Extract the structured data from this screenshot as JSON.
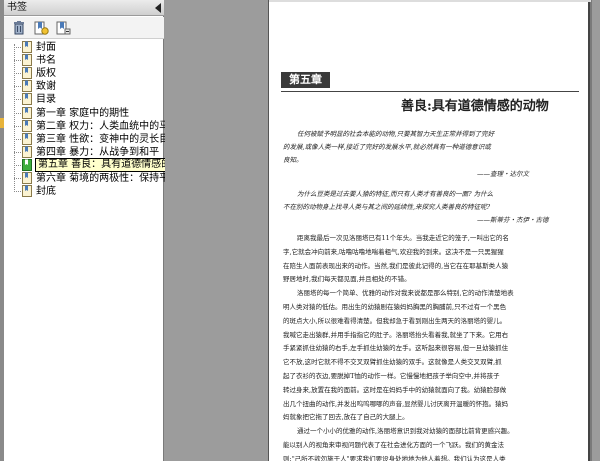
{
  "panel": {
    "title": "书签",
    "toolbar": [
      "delete-bookmark",
      "new-bookmark",
      "bookmark-options"
    ]
  },
  "bookmarks": [
    {
      "label": "封面"
    },
    {
      "label": "书名"
    },
    {
      "label": "版权"
    },
    {
      "label": "致谢"
    },
    {
      "label": "目录"
    },
    {
      "label": "第一章  家庭中的期性"
    },
    {
      "label": "第二章  权力：人类血统中的马基利"
    },
    {
      "label": "第三章  性欲：变神中的灵长目"
    },
    {
      "label": "第四章  暴力：从战争到和平"
    },
    {
      "label": "第五章  善良：具有道德情感的动物",
      "selected": true
    },
    {
      "label": "第六章  菊境的两极性：保持平衡"
    },
    {
      "label": "封底"
    }
  ],
  "document": {
    "chapter_label": "第五章",
    "chapter_title": "善良:具有道德情感的动物",
    "epigraph1": [
      "任何被赋予明显的社会本能的动物,只要其智力天生正常并得到了完好",
      "的发展,或像人类一样,接近了完好的发展水平,就必然具有一种道德意识或",
      "良知。"
    ],
    "epigraph1_attrib": "——查理・达尔文",
    "epigraph2": [
      "为什么豆类是过去要人猿的特征,而只有人类才有善良的一面? 为什么",
      "不在别的动物身上找寻人类与其之间的延续性,来探究人类善良的特征呢?"
    ],
    "epigraph2_attrib": "——斯蒂芬・杰伊・古德",
    "body": [
      "距离我最后一次见洛丽塔已有11个年头。当我走近它的笼子,一叫出它的名",
      "字,它就会冲向前来,咕噜咕噜地喘着粗气,欢迎我的到来。这决不是一只黑猩猩",
      "在陪生人面前表现出来的动作。当然,我们是彼此记得的,当它在在耶基斯类人猿",
      "野居地时,我们每天都见面,并且相处的不错。",
      "洛丽塔的每一个简单、优雅的动作对我来说都是那么特别,它的动作清楚地表",
      "明人类对猿的低估。用出生的幼猿剧在猿妈妈胸黑的胸脯前,只不过有一个黑色",
      "的斑点大小,所以很难看得清楚。但我却急于看到刚出生两天的洛丽塔的婴儿。",
      "我喊它走出猿群,并用手指指它的肚子。洛丽塔抬头看着我,就坐了下来。它用右",
      "手紧紧抓住幼猿的右手,左手抓住幼猿的左手。这听起来很容易,但一旦幼猿抓住",
      "它不放,这时它就不得不交叉双臂抓住幼猿的双手。这就像是人类交叉双臂,抓",
      "起了衣衫的衣边,要脱掉T恤的动作一样。它慢慢地把孩子举向空中,并将孩子",
      "转过身来,放置在我的面前。这时是在妈妈手中的幼猿就面向了我。幼猿脸部做",
      "出几个扭曲的动作,并发出呜呜哪哪的声音,显然婴儿讨厌离开温暖的怀抱。猿妈",
      "妈就象把它拖了回去,放在了自己的大腿上。",
      "通过一个小小的优雅的动作,洛丽塔意识到我对幼猿的面部比前背更感兴趣。",
      "能以别人的视角来审视问题代表了在社会进化方面的一个飞跃。我们的黄金法",
      "则:\"己所不欲勿施于人\"要求我们要设身处地地为他人着想。我们认为这是人类"
    ]
  }
}
